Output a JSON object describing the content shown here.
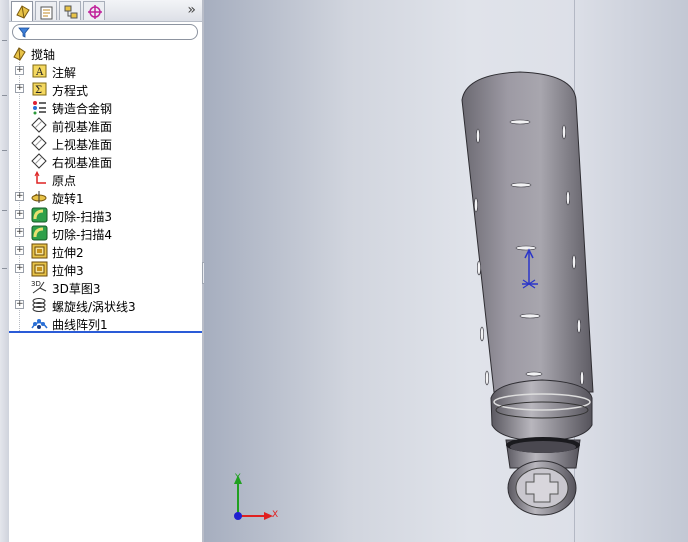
{
  "tabs": [
    {
      "name": "feature-manager-tab",
      "icon": "feature-manager-icon",
      "active": true
    },
    {
      "name": "property-manager-tab",
      "icon": "property-manager-icon",
      "active": false
    },
    {
      "name": "configuration-manager-tab",
      "icon": "configuration-manager-icon",
      "active": false
    },
    {
      "name": "dimxpert-tab",
      "icon": "crosshair-icon",
      "active": false
    }
  ],
  "panel": {
    "more_glyph": "»",
    "filter_icon": "filter-icon"
  },
  "tree": {
    "root": {
      "label": "搅轴",
      "icon": "part-icon"
    },
    "items": [
      {
        "label": "注解",
        "icon": "annotation-icon",
        "expandable": true
      },
      {
        "label": "方程式",
        "icon": "equation-icon",
        "expandable": true
      },
      {
        "label": "铸造合金钢",
        "icon": "material-icon",
        "expandable": false
      },
      {
        "label": "前视基准面",
        "icon": "plane-icon",
        "expandable": false
      },
      {
        "label": "上视基准面",
        "icon": "plane-icon",
        "expandable": false
      },
      {
        "label": "右视基准面",
        "icon": "plane-icon",
        "expandable": false
      },
      {
        "label": "原点",
        "icon": "origin-icon",
        "expandable": false
      },
      {
        "label": "旋转1",
        "icon": "revolve-icon",
        "expandable": true
      },
      {
        "label": "切除-扫描3",
        "icon": "swept-cut-icon",
        "expandable": true
      },
      {
        "label": "切除-扫描4",
        "icon": "swept-cut-icon",
        "expandable": true
      },
      {
        "label": "拉伸2",
        "icon": "extrude-icon",
        "expandable": true
      },
      {
        "label": "拉伸3",
        "icon": "extrude-icon",
        "expandable": true
      },
      {
        "label": "3D草图3",
        "icon": "sketch-3d-icon",
        "expandable": false
      },
      {
        "label": "螺旋线/涡状线3",
        "icon": "helix-icon",
        "expandable": true
      },
      {
        "label": "曲线阵列1",
        "icon": "curve-pattern-icon",
        "expandable": false
      }
    ]
  },
  "triad": {
    "x_label": "X",
    "y_label": "Y"
  },
  "colors": {
    "accent": "#2a5bd7",
    "part_body": "#8f8c95",
    "triad_x": "#e02020",
    "triad_y": "#20a020",
    "triad_z": "#2020d0"
  }
}
